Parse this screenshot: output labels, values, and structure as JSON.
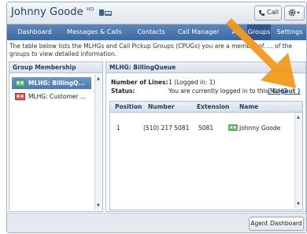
{
  "app": {
    "user_name": "Johnny Goode",
    "hd_badge": "HD",
    "call_label": "Call"
  },
  "nav": {
    "tabs": [
      {
        "label": "Dashboard"
      },
      {
        "label": "Messages & Calls"
      },
      {
        "label": "Contacts"
      },
      {
        "label": "Call Manager"
      },
      {
        "label": "Ap"
      },
      {
        "label": "Groups",
        "active": true
      },
      {
        "label": "Settings"
      }
    ]
  },
  "description": "The table below lists the MLHGs and Call Pickup Groups (CPUGs) you are a member of. ... of the groups to view detailed information.",
  "group_membership": {
    "heading": "Group Membership",
    "items": [
      {
        "label": "MLHG: BillingQ...",
        "selected": true,
        "icon": "group-icon-green"
      },
      {
        "label": "MLHG: Customer ...",
        "selected": false,
        "icon": "group-icon-red"
      }
    ]
  },
  "detail": {
    "heading": "MLHG: BillingQueue",
    "lines_label": "Number of Lines:",
    "lines_value": "1  (Logged in: 1)",
    "status_label": "Status:",
    "status_value": "You are currently logged in to this MLHG",
    "logout_label": "( Logout )",
    "columns": [
      "Position",
      "Number",
      "Extension",
      "Name"
    ],
    "rows": [
      {
        "position": "1",
        "number": "(510) 217 5081",
        "extension": "5081",
        "name": "Johnny Goode"
      }
    ]
  },
  "footer": {
    "agent_dashboard_label": "Agent Dashboard"
  },
  "colors": {
    "nav_bg": "#4a76b0",
    "arrow": "#f39a1e",
    "selected_item": "#5a84bd"
  }
}
